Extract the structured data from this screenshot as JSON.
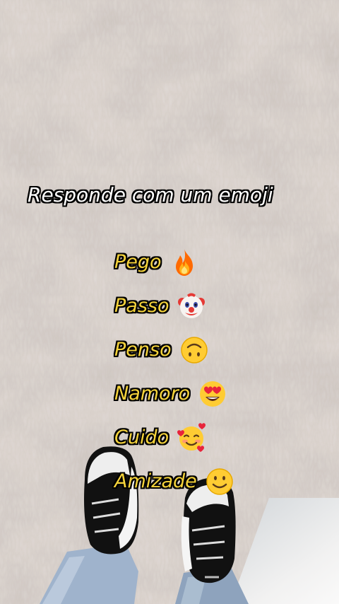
{
  "heading": "Responde com um emoji",
  "options": [
    {
      "label": "Pego",
      "icon": "fire-icon"
    },
    {
      "label": "Passo",
      "icon": "clown-face-icon"
    },
    {
      "label": "Penso",
      "icon": "upside-down-face-icon"
    },
    {
      "label": "Namoro",
      "icon": "heart-eyes-face-icon"
    },
    {
      "label": "Cuido",
      "icon": "smiling-face-with-hearts-icon"
    },
    {
      "label": "Amizade",
      "icon": "slightly-smiling-face-icon"
    }
  ],
  "colors": {
    "heading_text": "#ffffff",
    "option_text": "#f5d33b",
    "text_outline": "#000000",
    "rug_light": "#d8d0ca",
    "rug_dark": "#6d625d"
  }
}
